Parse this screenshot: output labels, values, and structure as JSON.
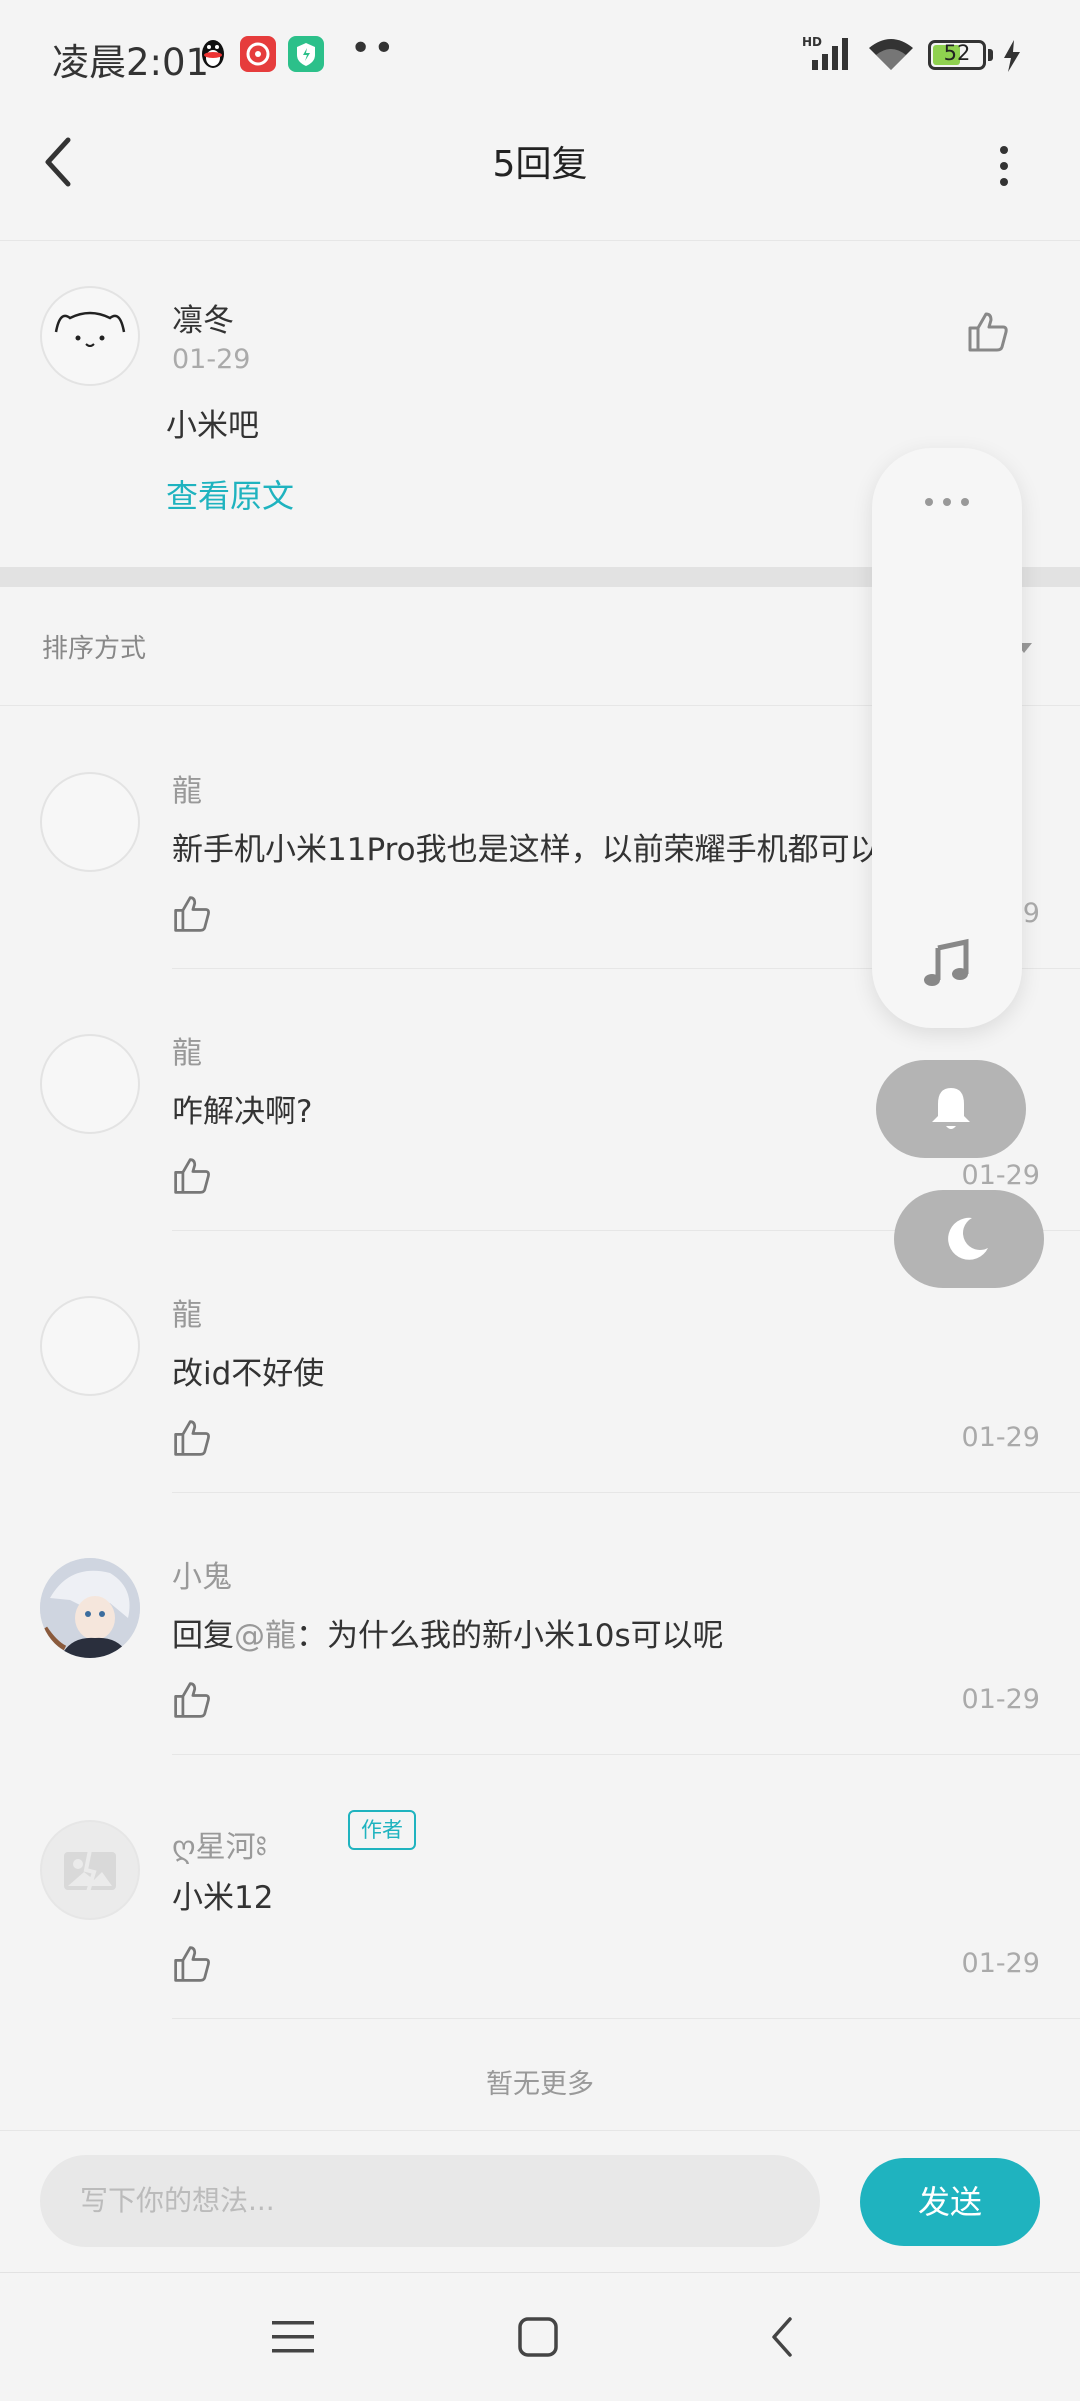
{
  "status_bar": {
    "time": "凌晨2:01",
    "battery": "52"
  },
  "header": {
    "title": "5回复"
  },
  "original_post": {
    "author": "凛冬",
    "date": "01-29",
    "content": "小米吧",
    "view_original": "查看原文"
  },
  "sort": {
    "label": "排序方式"
  },
  "replies": [
    {
      "author": "龍",
      "content": "新手机小米11Pro我也是这样，以前荣耀手机都可以玩",
      "date": "01-29"
    },
    {
      "author": "龍",
      "content": "咋解决啊?",
      "date": "01-29"
    },
    {
      "author": "龍",
      "content": "改id不好使",
      "date": "01-29"
    },
    {
      "author": "小鬼",
      "content_prefix": "回复",
      "mention": "@龍",
      "content": "：为什么我的新小米10s可以呢",
      "date": "01-29"
    },
    {
      "author": "ღ星河ཿ",
      "author_tag": "作者",
      "content": "小米12",
      "date": "01-29"
    }
  ],
  "no_more": "暂无更多",
  "input": {
    "placeholder": "写下你的想法..."
  },
  "send_button": "发送",
  "colors": {
    "accent": "#1fb3bf",
    "background": "#f4f4f4"
  }
}
